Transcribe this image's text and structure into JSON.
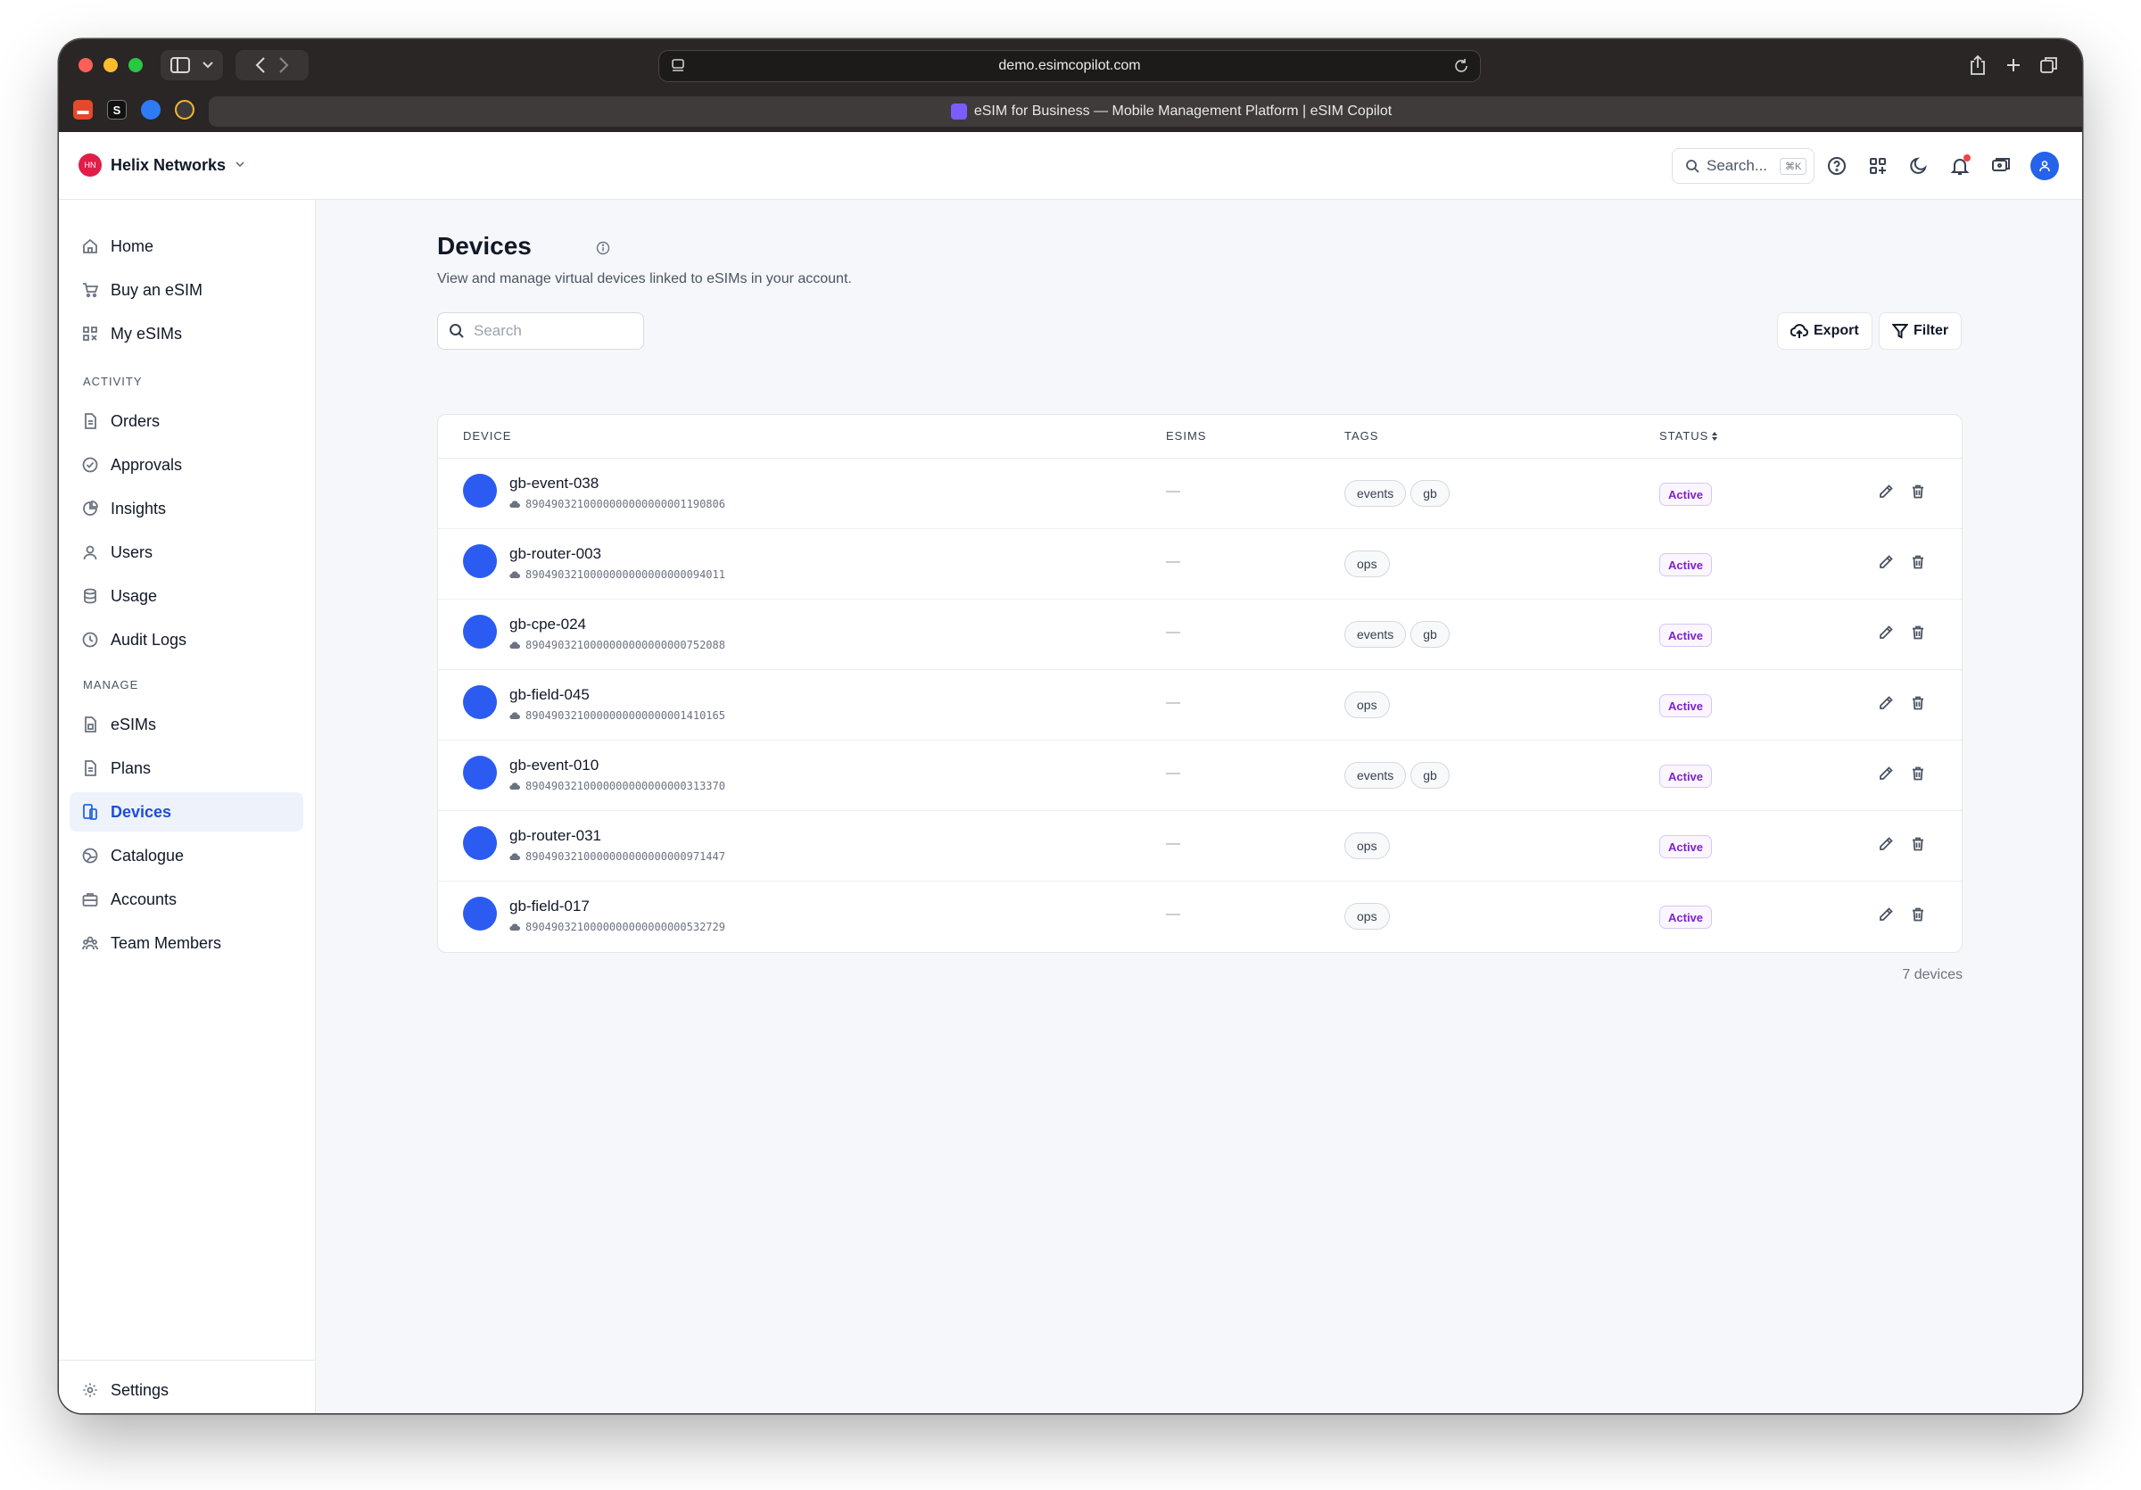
{
  "browser": {
    "url": "demo.esimcopilot.com",
    "tab_title": "eSIM for Business — Mobile Management Platform | eSIM Copilot"
  },
  "header": {
    "org_initials": "HN",
    "org_name": "Helix Networks",
    "search_placeholder": "Search...",
    "search_shortcut": "⌘K"
  },
  "sidebar": {
    "items_top": [
      {
        "label": "Home",
        "icon": "home-icon"
      },
      {
        "label": "Buy an eSIM",
        "icon": "cart-icon"
      },
      {
        "label": "My eSIMs",
        "icon": "qr-icon"
      }
    ],
    "section_activity": "ACTIVITY",
    "items_activity": [
      {
        "label": "Orders",
        "icon": "document-icon"
      },
      {
        "label": "Approvals",
        "icon": "check-circle-icon"
      },
      {
        "label": "Insights",
        "icon": "pie-chart-icon"
      },
      {
        "label": "Users",
        "icon": "user-icon"
      },
      {
        "label": "Usage",
        "icon": "database-icon"
      },
      {
        "label": "Audit Logs",
        "icon": "clock-icon"
      }
    ],
    "section_manage": "MANAGE",
    "items_manage": [
      {
        "label": "eSIMs",
        "icon": "sim-icon"
      },
      {
        "label": "Plans",
        "icon": "document-icon"
      },
      {
        "label": "Devices",
        "icon": "devices-icon"
      },
      {
        "label": "Catalogue",
        "icon": "globe-icon"
      },
      {
        "label": "Accounts",
        "icon": "briefcase-icon"
      },
      {
        "label": "Team Members",
        "icon": "team-icon"
      }
    ],
    "settings": "Settings",
    "active": "Devices"
  },
  "page": {
    "title": "Devices",
    "subtitle": "View and manage virtual devices linked to eSIMs in your account.",
    "search_placeholder": "Search",
    "export_label": "Export",
    "filter_label": "Filter",
    "count_label": "7 devices"
  },
  "table": {
    "columns": [
      "DEVICE",
      "ESIMS",
      "TAGS",
      "STATUS"
    ],
    "rows": [
      {
        "name": "gb-event-038",
        "iccid": "8904903210000000000000001190806",
        "esims": "—",
        "tags": [
          "events",
          "gb"
        ],
        "status": "Active"
      },
      {
        "name": "gb-router-003",
        "iccid": "8904903210000000000000000094011",
        "esims": "—",
        "tags": [
          "ops"
        ],
        "status": "Active"
      },
      {
        "name": "gb-cpe-024",
        "iccid": "8904903210000000000000000752088",
        "esims": "—",
        "tags": [
          "events",
          "gb"
        ],
        "status": "Active"
      },
      {
        "name": "gb-field-045",
        "iccid": "8904903210000000000000001410165",
        "esims": "—",
        "tags": [
          "ops"
        ],
        "status": "Active"
      },
      {
        "name": "gb-event-010",
        "iccid": "8904903210000000000000000313370",
        "esims": "—",
        "tags": [
          "events",
          "gb"
        ],
        "status": "Active"
      },
      {
        "name": "gb-router-031",
        "iccid": "8904903210000000000000000971447",
        "esims": "—",
        "tags": [
          "ops"
        ],
        "status": "Active"
      },
      {
        "name": "gb-field-017",
        "iccid": "8904903210000000000000000532729",
        "esims": "—",
        "tags": [
          "ops"
        ],
        "status": "Active"
      }
    ]
  },
  "colors": {
    "accent": "#2563eb",
    "device_dot": "#2b5bf1",
    "status_active": "#7e22ce",
    "notification_dot": "#ef4444"
  }
}
